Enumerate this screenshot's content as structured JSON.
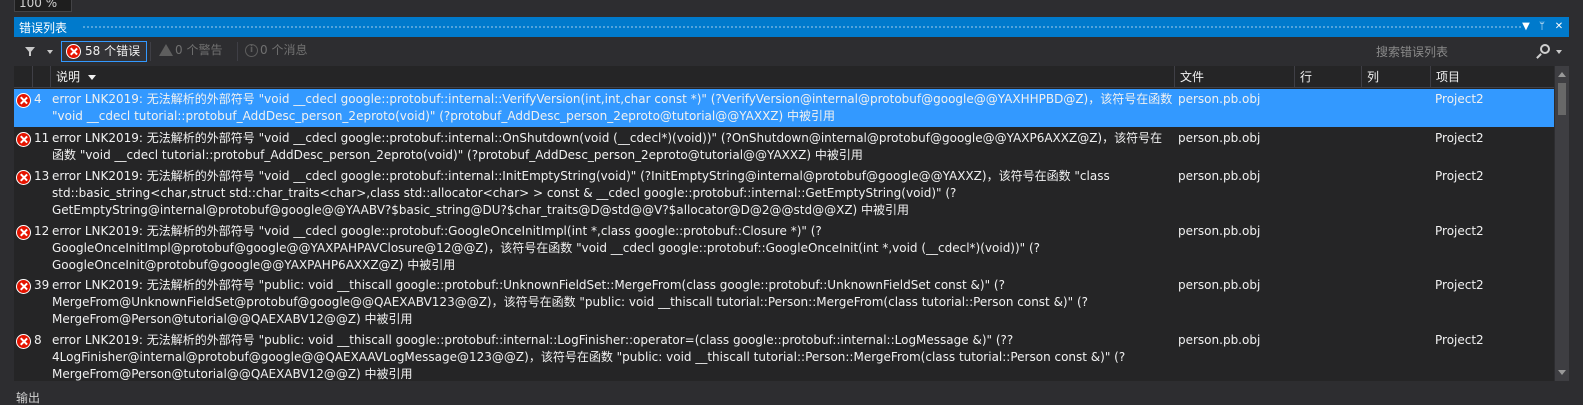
{
  "zoom": {
    "value": "100 %"
  },
  "panel": {
    "title": "错误列表",
    "dropdown_glyph": "▼",
    "pin_glyph": "ᛘ",
    "close_glyph": "✕"
  },
  "toolbar": {
    "errors_label": "58 个错误",
    "warnings_label": "0 个警告",
    "messages_label": "0 个消息",
    "info_glyph": "i",
    "search_placeholder": "搜索错误列表"
  },
  "columns": {
    "description": "说明",
    "file": "文件",
    "line": "行",
    "column": "列",
    "project": "项目"
  },
  "colors": {
    "accent": "#007acc",
    "selection": "#3399ff",
    "error": "#e51400"
  },
  "icons": [
    "funnel-icon",
    "error-icon",
    "warning-icon",
    "info-icon",
    "search-icon"
  ],
  "rows": [
    {
      "num": "4",
      "desc": "error LNK2019: 无法解析的外部符号 \"void __cdecl google::protobuf::internal::VerifyVersion(int,int,char const *)\" (?VerifyVersion@internal@protobuf@google@@YAXHHPBD@Z)，该符号在函数 \"void __cdecl tutorial::protobuf_AddDesc_person_2eproto(void)\" (?protobuf_AddDesc_person_2eproto@tutorial@@YAXXZ) 中被引用",
      "file": "person.pb.obj",
      "project": "Project2"
    },
    {
      "num": "11",
      "desc": "error LNK2019: 无法解析的外部符号 \"void __cdecl google::protobuf::internal::OnShutdown(void (__cdecl*)(void))\" (?OnShutdown@internal@protobuf@google@@YAXP6AXXZ@Z)，该符号在函数 \"void __cdecl tutorial::protobuf_AddDesc_person_2eproto(void)\" (?protobuf_AddDesc_person_2eproto@tutorial@@YAXXZ) 中被引用",
      "file": "person.pb.obj",
      "project": "Project2"
    },
    {
      "num": "13",
      "desc": "error LNK2019: 无法解析的外部符号 \"void __cdecl google::protobuf::internal::InitEmptyString(void)\" (?InitEmptyString@internal@protobuf@google@@YAXXZ)，该符号在函数 \"class std::basic_string<char,struct std::char_traits<char>,class std::allocator<char> > const & __cdecl google::protobuf::internal::GetEmptyString(void)\" (?GetEmptyString@internal@protobuf@google@@YAABV?$basic_string@DU?$char_traits@D@std@@V?$allocator@D@2@@std@@XZ) 中被引用",
      "file": "person.pb.obj",
      "project": "Project2"
    },
    {
      "num": "12",
      "desc": "error LNK2019: 无法解析的外部符号 \"void __cdecl google::protobuf::GoogleOnceInitImpl(int *,class google::protobuf::Closure *)\" (?GoogleOnceInitImpl@protobuf@google@@YAXPAHPAVClosure@12@@Z)，该符号在函数 \"void __cdecl google::protobuf::GoogleOnceInit(int *,void (__cdecl*)(void))\" (?GoogleOnceInit@protobuf@google@@YAXPAHP6AXXZ@Z) 中被引用",
      "file": "person.pb.obj",
      "project": "Project2"
    },
    {
      "num": "39",
      "desc": "error LNK2019: 无法解析的外部符号 \"public: void __thiscall google::protobuf::UnknownFieldSet::MergeFrom(class google::protobuf::UnknownFieldSet const &)\" (?MergeFrom@UnknownFieldSet@protobuf@google@@QAEXABV123@@Z)，该符号在函数 \"public: void __thiscall tutorial::Person::MergeFrom(class tutorial::Person const &)\" (?MergeFrom@Person@tutorial@@QAEXABV12@@Z) 中被引用",
      "file": "person.pb.obj",
      "project": "Project2"
    },
    {
      "num": "8",
      "desc": "error LNK2019: 无法解析的外部符号 \"public: void __thiscall google::protobuf::internal::LogFinisher::operator=(class google::protobuf::internal::LogMessage &)\" (??4LogFinisher@internal@protobuf@google@@QAEXAAVLogMessage@123@@Z)，该符号在函数 \"public: void __thiscall tutorial::Person::MergeFrom(class tutorial::Person const &)\" (?MergeFrom@Person@tutorial@@QAEXABV12@@Z) 中被引用",
      "file": "person.pb.obj",
      "project": "Project2"
    }
  ],
  "footer": {
    "output_tab": "输出"
  }
}
